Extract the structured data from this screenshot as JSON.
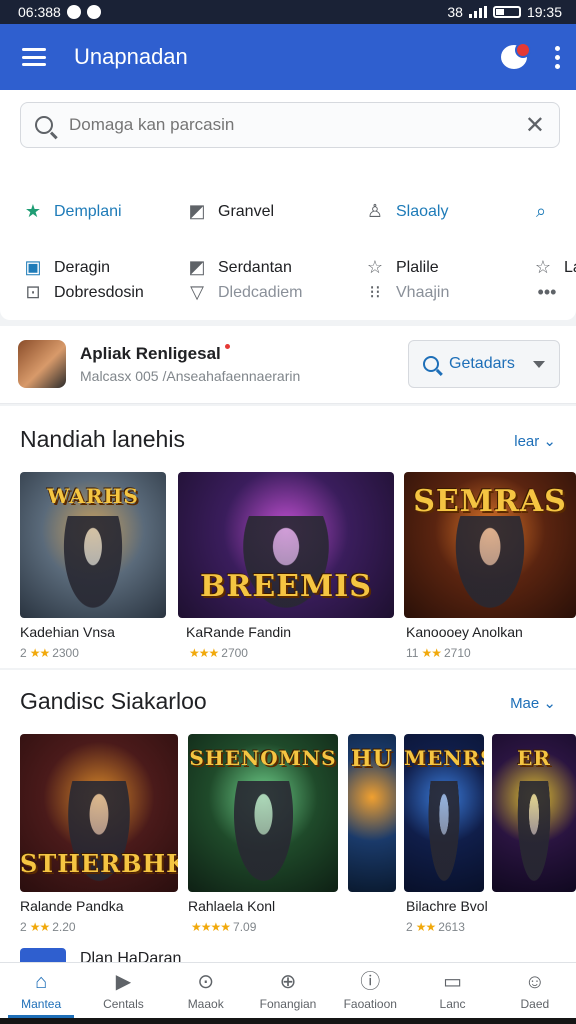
{
  "status_bar": {
    "time_left": "06:388",
    "time_right": "19:35",
    "indicators": "38"
  },
  "app_bar": {
    "title": "Unapnadan"
  },
  "search": {
    "placeholder": "Domaga kan parcasin"
  },
  "categories": {
    "row1": [
      {
        "label": "Demplani",
        "icon": "star-icon",
        "style": "blue"
      },
      {
        "label": "Granvel",
        "icon": "edit-icon",
        "style": "normal"
      },
      {
        "label": "Slaoaly",
        "icon": "person-icon",
        "style": "blue"
      }
    ],
    "row2": [
      {
        "label": "Deragin",
        "icon": "image-icon",
        "style": "normal"
      },
      {
        "label": "Serdantan",
        "icon": "edit-icon",
        "style": "normal"
      },
      {
        "label": "Plalile",
        "icon": "star-outline-icon",
        "style": "normal"
      },
      {
        "label": "La",
        "icon": "star-outline-icon",
        "style": "normal"
      }
    ],
    "row3": [
      {
        "label": "Dobresdosin",
        "icon": "window-icon",
        "style": "normal"
      },
      {
        "label": "Dledcadiem",
        "icon": "triangle-icon",
        "style": "muted"
      },
      {
        "label": "Vhaajin",
        "icon": "grid-icon",
        "style": "muted"
      }
    ]
  },
  "featured_app": {
    "name": "Apliak Renligesal",
    "subtitle": "Malcasx 005 /Anseahafaennaerarin",
    "button_label": "Getadars"
  },
  "sections": [
    {
      "title": "Nandiah lanehis",
      "more": "lear",
      "items": [
        {
          "title": "Kadehian Vnsa",
          "prefix": "2",
          "stars": "★★",
          "count": "2300",
          "caption": "WARHS",
          "colors": [
            "#5a6a7a",
            "#c8a060",
            "#2a3440"
          ]
        },
        {
          "title": "KaRande Fandin",
          "prefix": "",
          "stars": "★★★",
          "count": "2700",
          "caption": "BREEMIS",
          "colors": [
            "#3a1d5c",
            "#c04fd0",
            "#1e1030"
          ]
        },
        {
          "title": "Kanoooey Anolkan",
          "prefix": "11",
          "stars": "★★",
          "count": "2710",
          "caption": "SEMRAS",
          "colors": [
            "#5a2410",
            "#e0782a",
            "#2a1008"
          ]
        }
      ]
    },
    {
      "title": "Gandisc Siakarloo",
      "more": "Mae",
      "items": [
        {
          "title": "Ralande Pandka",
          "prefix": "2",
          "stars": "★★",
          "count": "2.20",
          "caption": "STHERBHK",
          "colors": [
            "#4a1a1a",
            "#d98a2a",
            "#2a0e0e"
          ]
        },
        {
          "title": "Rahlaela Konl",
          "prefix": "",
          "stars": "★★★★",
          "count": "7.09",
          "caption": "SHENOMNS",
          "colors": [
            "#1f4a2a",
            "#6fd08a",
            "#0e2014"
          ]
        },
        {
          "title": "",
          "prefix": "",
          "stars": "",
          "count": "",
          "caption": "HU",
          "colors": [
            "#1a3a6a",
            "#f0a030",
            "#0a1a30"
          ]
        },
        {
          "title": "Bilachre Bvol",
          "prefix": "2",
          "stars": "★★",
          "count": "2613",
          "caption": "MENRS",
          "colors": [
            "#101e4a",
            "#3a7ad8",
            "#08102a"
          ]
        },
        {
          "title": "",
          "prefix": "",
          "stars": "",
          "count": "",
          "caption": "ER",
          "colors": [
            "#2a1440",
            "#e0c030",
            "#100820"
          ]
        }
      ]
    }
  ],
  "peek_row": {
    "text": "Dlan HaDaran"
  },
  "bottom_nav": [
    {
      "label": "Mantea",
      "icon": "home-icon",
      "glyph": "⌂",
      "active": true
    },
    {
      "label": "Centals",
      "icon": "play-icon",
      "glyph": "▶",
      "active": false
    },
    {
      "label": "Maaok",
      "icon": "search-icon",
      "glyph": "⊙",
      "active": false
    },
    {
      "label": "Fonangian",
      "icon": "add-circle-icon",
      "glyph": "⊕",
      "active": false
    },
    {
      "label": "Faoatioon",
      "icon": "info-icon",
      "glyph": "ⓘ",
      "active": false
    },
    {
      "label": "Lanc",
      "icon": "message-icon",
      "glyph": "▭",
      "active": false
    },
    {
      "label": "Daed",
      "icon": "profile-icon",
      "glyph": "☺",
      "active": false
    }
  ]
}
